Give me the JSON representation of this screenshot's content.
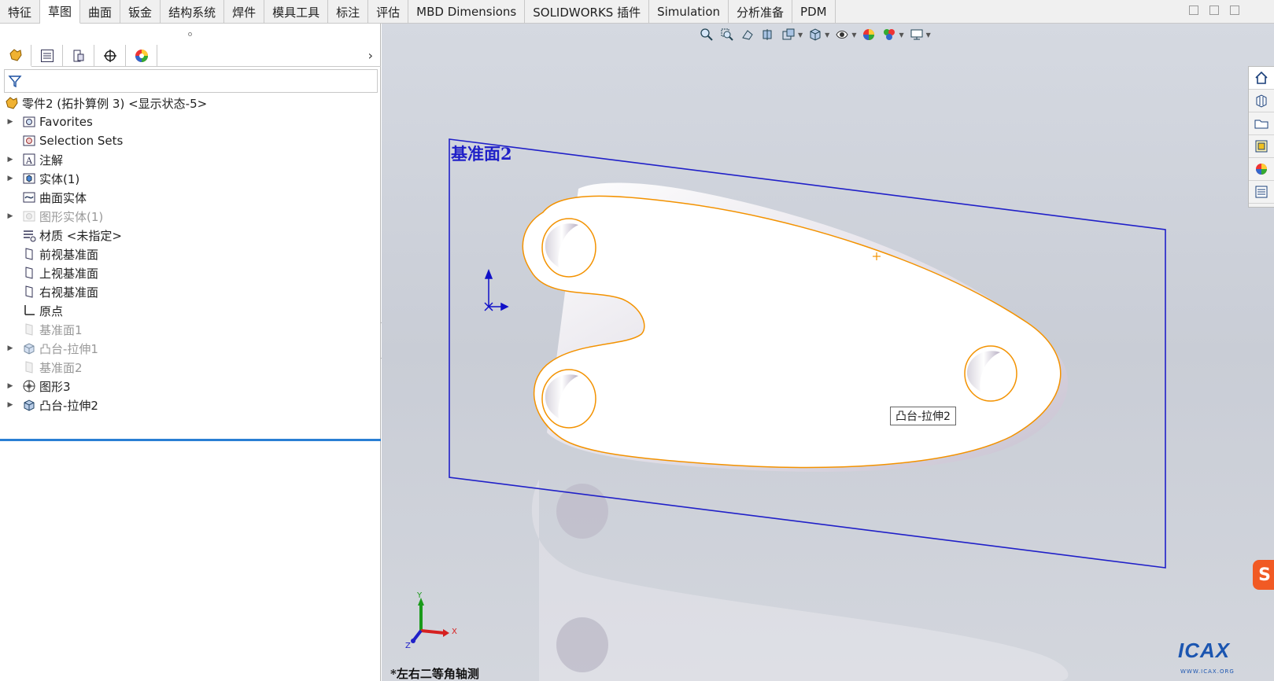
{
  "ribbon": {
    "tabs": [
      "特征",
      "草图",
      "曲面",
      "钣金",
      "结构系统",
      "焊件",
      "模具工具",
      "标注",
      "评估",
      "MBD Dimensions",
      "SOLIDWORKS 插件",
      "Simulation",
      "分析准备",
      "PDM"
    ],
    "active_tab": "草图"
  },
  "feature_tree": {
    "root": "零件2 (拓扑算例 3) <显示状态-5>",
    "items": [
      {
        "label": "Favorites",
        "icon": "favorites-icon",
        "expandable": true,
        "dim": false
      },
      {
        "label": "Selection Sets",
        "icon": "selection-sets-icon",
        "expandable": false,
        "dim": false
      },
      {
        "label": "注解",
        "icon": "annotation-icon",
        "expandable": true,
        "dim": false
      },
      {
        "label": "实体(1)",
        "icon": "solid-bodies-icon",
        "expandable": true,
        "dim": false
      },
      {
        "label": "曲面实体",
        "icon": "surface-bodies-icon",
        "expandable": false,
        "dim": false
      },
      {
        "label": "图形实体(1)",
        "icon": "graphics-bodies-icon",
        "expandable": true,
        "dim": true
      },
      {
        "label": "材质 <未指定>",
        "icon": "material-icon",
        "expandable": false,
        "dim": false
      },
      {
        "label": "前视基准面",
        "icon": "plane-icon",
        "expandable": false,
        "dim": false
      },
      {
        "label": "上视基准面",
        "icon": "plane-icon",
        "expandable": false,
        "dim": false
      },
      {
        "label": "右视基准面",
        "icon": "plane-icon",
        "expandable": false,
        "dim": false
      },
      {
        "label": "原点",
        "icon": "origin-icon",
        "expandable": false,
        "dim": false
      },
      {
        "label": "基准面1",
        "icon": "plane-hidden-icon",
        "expandable": false,
        "dim": true
      },
      {
        "label": "凸台-拉伸1",
        "icon": "extrude-icon",
        "expandable": true,
        "dim": true
      },
      {
        "label": "基准面2",
        "icon": "plane-hidden-icon",
        "expandable": false,
        "dim": true
      },
      {
        "label": "图形3",
        "icon": "graphics-icon",
        "expandable": true,
        "dim": false
      },
      {
        "label": "凸台-拉伸2",
        "icon": "extrude-icon",
        "expandable": true,
        "dim": false
      }
    ]
  },
  "viewport": {
    "plane_label": "基准面2",
    "tooltip": "凸台-拉伸2",
    "view_name": "*左右二等角轴测",
    "triad": {
      "x": "X",
      "y": "Y",
      "z": "Z"
    },
    "watermark": "ICAX",
    "watermark_sub": "WWW.ICAX.ORG",
    "sogou": "S"
  },
  "colors": {
    "accent_blue": "#2a7fd4",
    "plane_blue": "#2020c8",
    "edge_orange": "#f39200",
    "viewport_bg": "#cdd1d9"
  }
}
